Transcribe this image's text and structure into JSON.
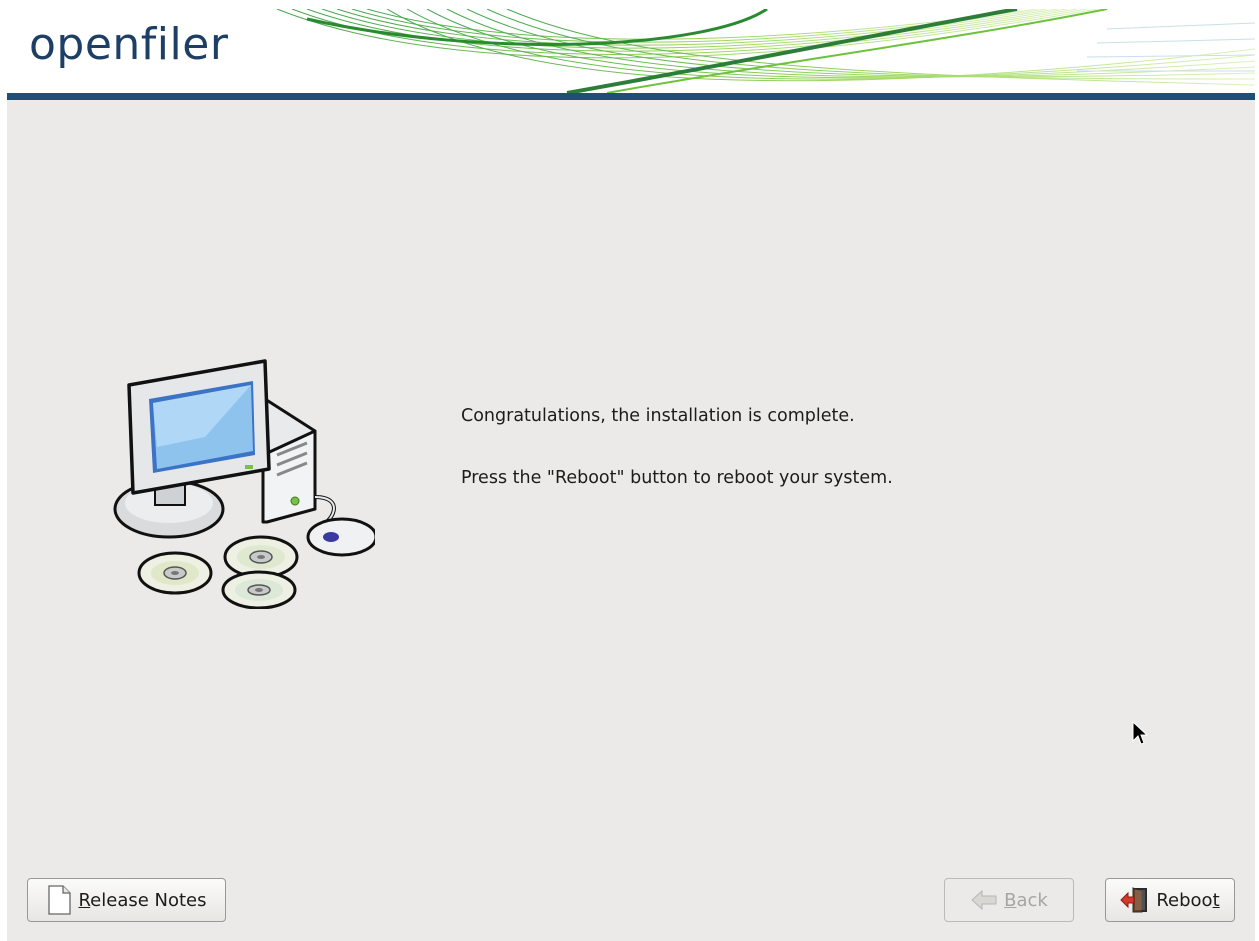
{
  "header": {
    "logo_text": "openfiler"
  },
  "main": {
    "line1": "Congratulations, the installation is complete.",
    "line2": "Press the \"Reboot\" button to reboot your system."
  },
  "buttons": {
    "release_notes": {
      "mnemonic": "R",
      "rest": "elease Notes",
      "icon": "document-icon",
      "enabled": true
    },
    "back": {
      "mnemonic": "B",
      "rest": "ack",
      "icon": "back-arrow-icon",
      "enabled": false
    },
    "reboot": {
      "prefix": "Reboo",
      "mnemonic": "t",
      "icon": "exit-door-icon",
      "enabled": true
    }
  },
  "colors": {
    "header_bar": "#1f4e79",
    "logo": "#1d3f66",
    "background": "#eceae8",
    "swoosh": "#5dbb2a"
  }
}
